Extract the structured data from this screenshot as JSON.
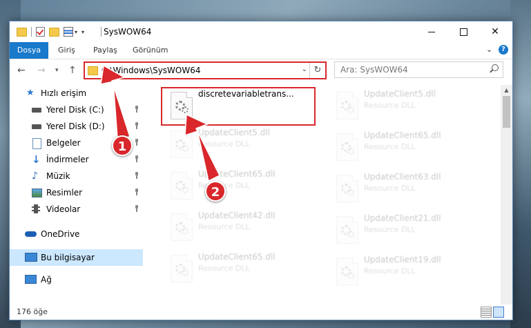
{
  "window": {
    "title": "SysWOW64"
  },
  "ribbon": {
    "tabs": [
      "Dosya",
      "Giriş",
      "Paylaş",
      "Görünüm"
    ],
    "help": "?"
  },
  "address": {
    "path": "C:\\Windows\\SysWOW64"
  },
  "search": {
    "placeholder": "Ara: SysWOW64"
  },
  "sidebar": {
    "items": [
      {
        "label": "Hızlı erişim",
        "icon": "star-icon"
      },
      {
        "label": "Yerel Disk (C:)",
        "icon": "drive-icon",
        "pinned": true
      },
      {
        "label": "Yerel Disk (D:)",
        "icon": "drive-icon",
        "pinned": true
      },
      {
        "label": "Belgeler",
        "icon": "documents-icon",
        "pinned": true
      },
      {
        "label": "İndirmeler",
        "icon": "download-icon",
        "pinned": true
      },
      {
        "label": "Müzik",
        "icon": "music-icon",
        "pinned": true
      },
      {
        "label": "Resimler",
        "icon": "pictures-icon",
        "pinned": true
      },
      {
        "label": "Videolar",
        "icon": "videos-icon",
        "pinned": true
      },
      {
        "label": "OneDrive",
        "icon": "cloud-icon"
      },
      {
        "label": "Bu bilgisayar",
        "icon": "computer-icon",
        "selected": true
      },
      {
        "label": "Ağ",
        "icon": "network-icon"
      }
    ]
  },
  "files": {
    "highlighted": {
      "name": "discretevariabletrans..."
    },
    "left_column": [
      {
        "name": "UpdateClient5.dll",
        "type": "Resource DLL"
      },
      {
        "name": "UpdateClient65.dll",
        "type": "Resource DLL"
      },
      {
        "name": "UpdateClient42.dll",
        "type": "Resource DLL"
      },
      {
        "name": "UpdateClient65.dll",
        "type": "Resource DLL"
      }
    ],
    "right_column": [
      {
        "name": "UpdateClient5.dll",
        "type": "Resource DLL"
      },
      {
        "name": "UpdateClient65.dll",
        "type": "Resource DLL"
      },
      {
        "name": "UpdateClient63.dll",
        "type": "Resource DLL"
      },
      {
        "name": "UpdateClient21.dll",
        "type": "Resource DLL"
      },
      {
        "name": "UpdateClient19.dll",
        "type": "Resource DLL"
      }
    ]
  },
  "status": {
    "count": "176 öğe"
  },
  "callouts": {
    "one": "1",
    "two": "2"
  },
  "colors": {
    "accent": "#1979ca",
    "highlight": "#d9272b",
    "selected": "#cce8ff"
  }
}
